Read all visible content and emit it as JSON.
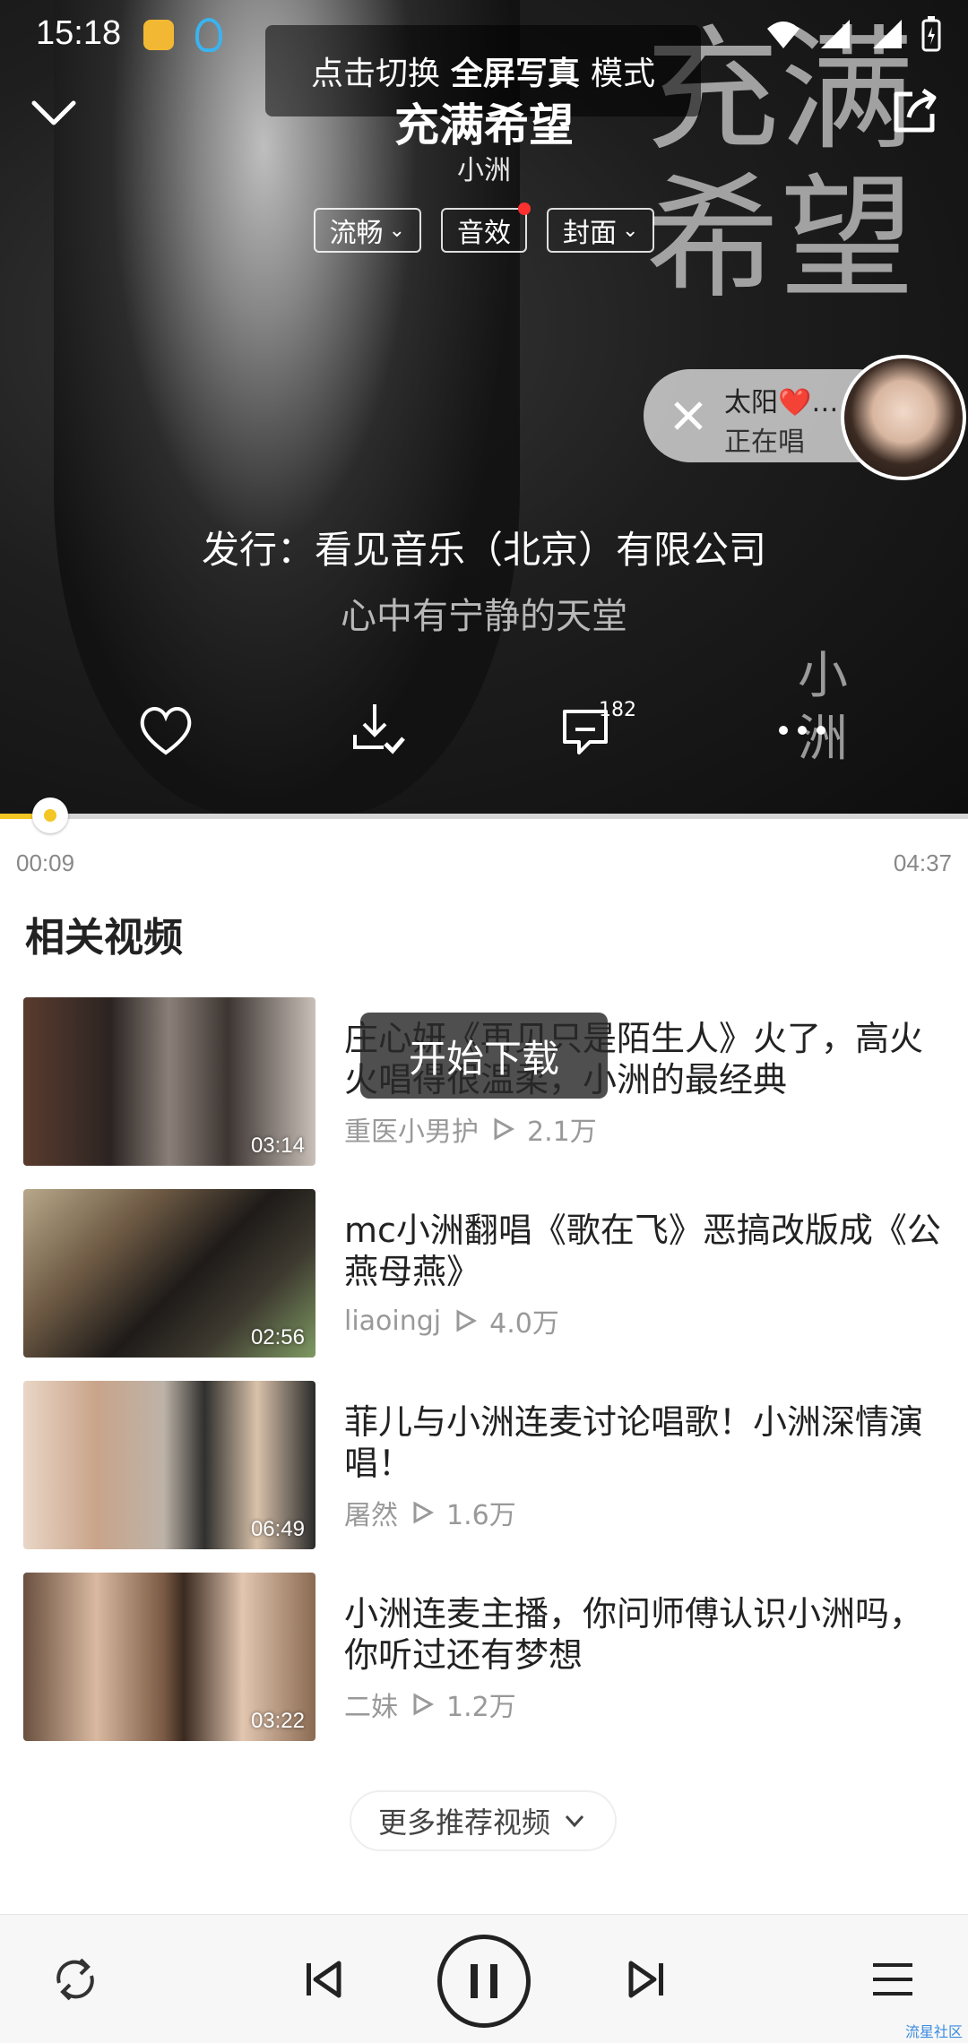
{
  "status_bar": {
    "time": "15:18"
  },
  "toast_top": {
    "prefix": "点击切换",
    "bold": "全屏写真",
    "suffix": "模式"
  },
  "song": {
    "title": "充满希望",
    "artist": "小洲"
  },
  "chips": {
    "quality": "流畅",
    "effects": "音效",
    "cover": "封面"
  },
  "cover_art": {
    "calligraphy": "充满希望",
    "small_text": "小洲"
  },
  "singing": {
    "name": "太阳❤️…",
    "status": "正在唱"
  },
  "publisher": "发行：看见音乐（北京）有限公司",
  "lyric": "心中有宁静的天堂",
  "actions": {
    "comment_count": "182"
  },
  "progress": {
    "current": "00:09",
    "total": "04:37",
    "fraction": 0.033
  },
  "related": {
    "title": "相关视频",
    "videos": [
      {
        "title": "庄心妍《再见只是陌生人》火了，高火火唱得很温柔，小洲的最经典",
        "author": "重医小男护",
        "views": "2.1万",
        "duration": "03:14"
      },
      {
        "title": "mc小洲翻唱《歌在飞》恶搞改版成《公燕母燕》",
        "author": "liaoingj",
        "views": "4.0万",
        "duration": "02:56"
      },
      {
        "title": "菲儿与小洲连麦讨论唱歌！小洲深情演唱！",
        "author": "屠然",
        "views": "1.6万",
        "duration": "06:49"
      },
      {
        "title": "小洲连麦主播，你问师傅认识小洲吗，你听过还有梦想",
        "author": "二妹",
        "views": "1.2万",
        "duration": "03:22"
      }
    ]
  },
  "center_toast": "开始下载",
  "more_videos": "更多推荐视频",
  "watermark": "流星社区",
  "colors": {
    "accent": "#f3c623",
    "notification_dot": "#ff3030"
  },
  "icons": [
    "collapse-icon",
    "share-icon",
    "heart-icon",
    "download-icon",
    "comment-icon",
    "more-icon",
    "repeat-icon",
    "previous-icon",
    "pause-icon",
    "next-icon",
    "playlist-icon"
  ]
}
